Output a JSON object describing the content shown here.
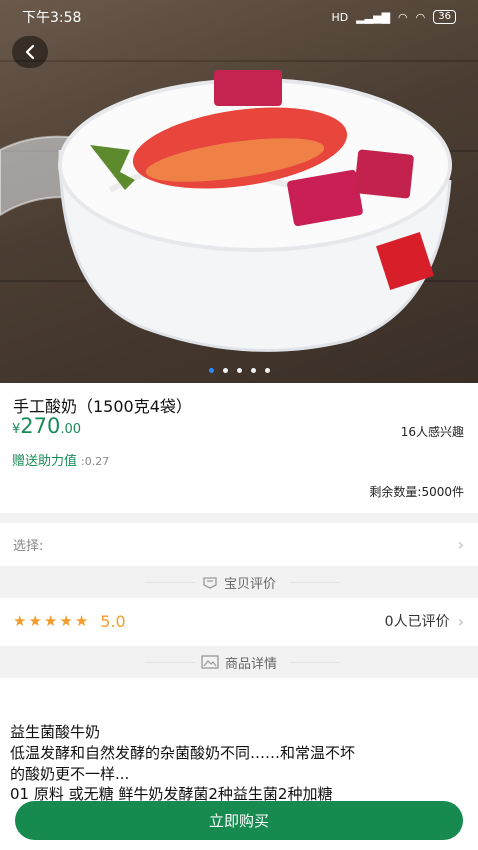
{
  "status_bar": {
    "time": "下午3:58",
    "network": "HD",
    "battery": "36"
  },
  "gallery": {
    "image": "yogurt-with-strawberry-and-dragon-fruit",
    "slide_count": 5,
    "active_slide": 1
  },
  "product": {
    "title": "手工酸奶（1500克4袋）",
    "price_currency": "¥",
    "price_integer": "270",
    "price_decimal": ".00",
    "interest": "16人感兴趣",
    "bonus_label": "赠送助力值",
    "bonus_value": ":0.27",
    "stock": "剩余数量:5000件"
  },
  "select_row": {
    "label": "选择:"
  },
  "reviews_section": {
    "title": "宝贝评价",
    "stars": 5,
    "score": "5.0",
    "count_text": "0人已评价"
  },
  "details_section": {
    "title": "商品详情",
    "lines": [
      "益生菌酸牛奶",
      "低温发酵和自然发酵的杂菌酸奶不同……和常温不坏",
      "的酸奶更不一样...",
      "01 原料 或无糖 鲜牛奶发酵菌2种益生菌2种加糖"
    ]
  },
  "buy_button": {
    "label": "立即购买"
  },
  "colors": {
    "accent_green": "#178a4f",
    "star_orange": "#f39c2c",
    "page_gray": "#f2f2f2"
  }
}
